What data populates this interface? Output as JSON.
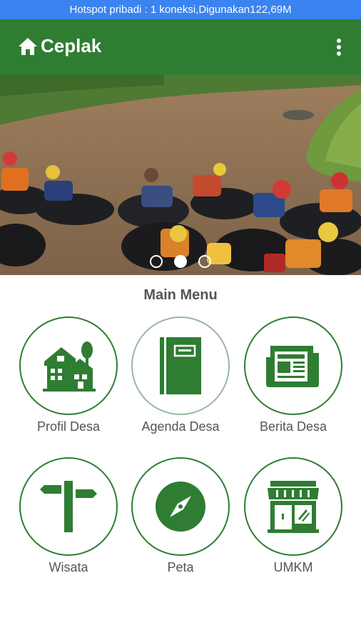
{
  "status_bar": {
    "text": "Hotspot pribadi : 1 koneksi,Digunakan122,69M"
  },
  "app_bar": {
    "title": "Ceplak",
    "home_icon": "home-icon",
    "overflow_icon": "more-vert-icon"
  },
  "banner": {
    "image": "river-tubing-photo",
    "slide_count": 3,
    "active_slide": 2
  },
  "main_menu": {
    "title": "Main Menu",
    "items": [
      {
        "label": "Profil Desa",
        "icon": "village-icon"
      },
      {
        "label": "Agenda Desa",
        "icon": "notebook-icon"
      },
      {
        "label": "Berita Desa",
        "icon": "newspaper-icon"
      },
      {
        "label": "Wisata",
        "icon": "signpost-icon"
      },
      {
        "label": "Peta",
        "icon": "compass-icon"
      },
      {
        "label": "UMKM",
        "icon": "storefront-icon"
      }
    ]
  },
  "colors": {
    "status_bar": "#3b83f0",
    "app_bar": "#2e7d32",
    "accent_green": "#2e7d32",
    "menu_text": "#555555"
  }
}
